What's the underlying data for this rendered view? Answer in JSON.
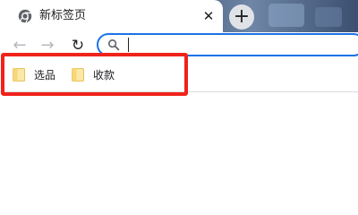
{
  "tab": {
    "title": "新标签页",
    "favicon": "chrome-icon",
    "close_glyph": "✕"
  },
  "new_tab": {
    "glyph": "+"
  },
  "toolbar": {
    "back_glyph": "←",
    "forward_glyph": "→",
    "reload_glyph": "↻"
  },
  "omnibox": {
    "value": "",
    "placeholder": "",
    "icon": "search-icon",
    "focus_color": "#1a73e8"
  },
  "bookmarks": {
    "items": [
      {
        "label": "选品",
        "icon": "folder-icon"
      },
      {
        "label": "收款",
        "icon": "folder-icon"
      }
    ]
  },
  "highlight": {
    "color": "#f0221a"
  }
}
